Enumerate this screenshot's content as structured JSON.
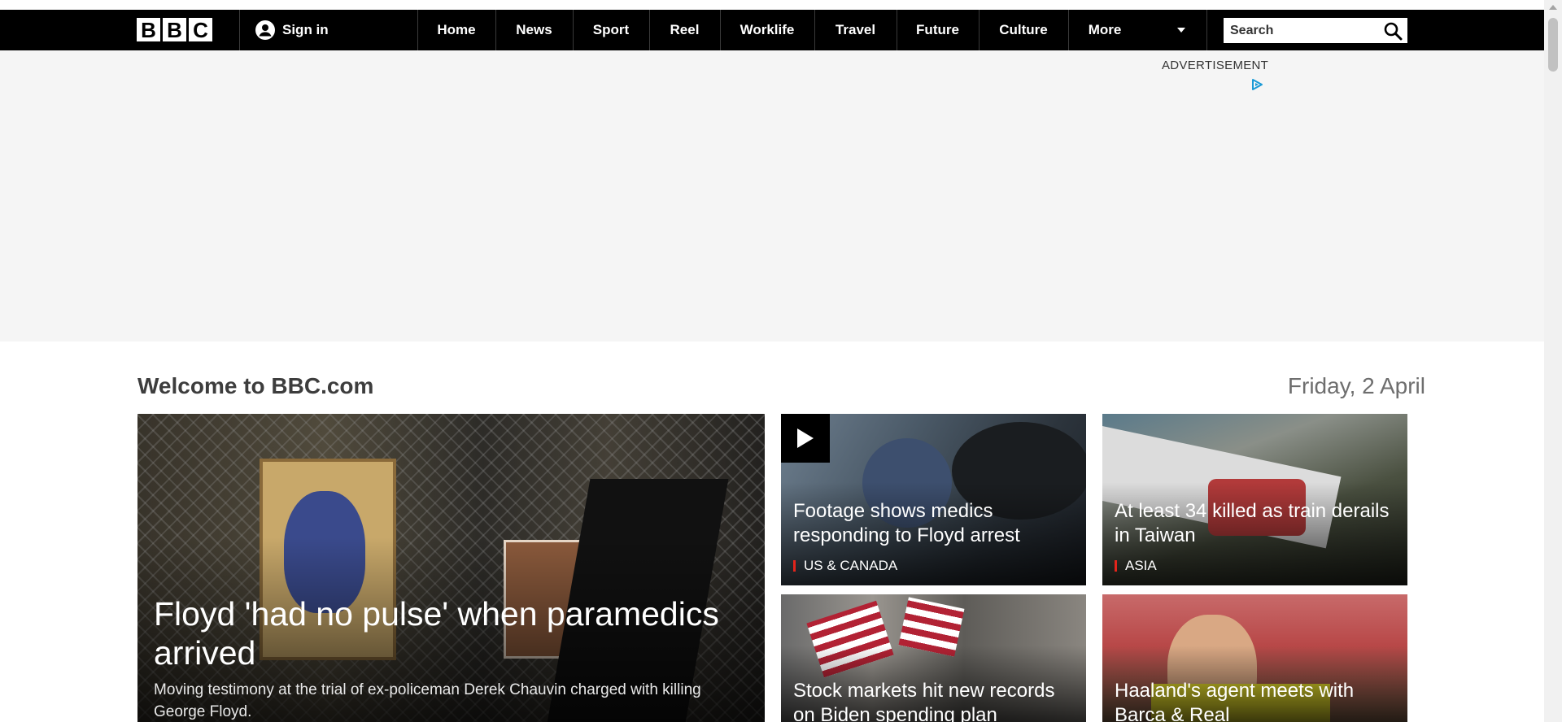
{
  "header": {
    "logo_letters": [
      "B",
      "B",
      "C"
    ],
    "sign_in": "Sign in",
    "nav": [
      "Home",
      "News",
      "Sport",
      "Reel",
      "Worklife",
      "Travel",
      "Future",
      "Culture",
      "More"
    ],
    "search_placeholder": "Search"
  },
  "ad": {
    "label": "ADVERTISEMENT"
  },
  "main": {
    "welcome": "Welcome to BBC.com",
    "date": "Friday, 2 April"
  },
  "stories": [
    {
      "title": "Floyd 'had no pulse' when paramedics arrived",
      "summary": "Moving testimony at the trial of ex-policeman Derek Chauvin charged with killing George Floyd."
    },
    {
      "title": "Footage shows medics responding to Floyd arrest",
      "tag": "US & CANADA",
      "video": true
    },
    {
      "title": "At least 34 killed as train derails in Taiwan",
      "tag": "ASIA"
    },
    {
      "title": "Stock markets hit new records on Biden spending plan"
    },
    {
      "title": "Haaland's agent meets with Barca & Real"
    }
  ],
  "colors": {
    "nav_bg": "#000000",
    "ad_bg": "#f5f5f5",
    "tag_accent": "#e3241b",
    "adchoices": "#1a9ad6"
  }
}
